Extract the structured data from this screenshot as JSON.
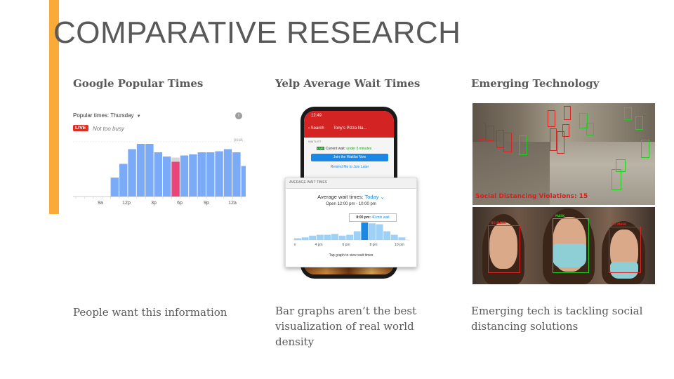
{
  "slide": {
    "title": "COMPARATIVE RESEARCH",
    "accent_color": "#F9AB38",
    "text_color": "#595959"
  },
  "columns": [
    {
      "heading": "Google Popular Times",
      "caption": "People want this information"
    },
    {
      "heading": "Yelp Average Wait Times",
      "caption": "Bar graphs aren’t the best visualization of real world density"
    },
    {
      "heading": "Emerging Technology",
      "caption": "Emerging tech is tackling social distancing solutions"
    }
  ],
  "google_popular_times": {
    "label": "Popular times: Thursday",
    "live_badge": "LIVE",
    "status": "Not too busy",
    "peak_label": "peak",
    "info_icon": "info-icon",
    "chart_data": {
      "type": "bar",
      "categories": [
        "8a",
        "9a",
        "10a",
        "11a",
        "12p",
        "1p",
        "2p",
        "3p",
        "4p",
        "5p",
        "6p",
        "7p",
        "8p",
        "9p",
        "10p",
        "11p",
        "12a"
      ],
      "x_tick_labels": [
        "9a",
        "12p",
        "3p",
        "6p",
        "9p",
        "12a"
      ],
      "values": [
        18,
        31,
        45,
        50,
        50,
        42,
        38,
        37,
        39,
        40,
        42,
        42,
        43,
        45,
        42,
        29
      ],
      "live_value": 33,
      "live_index": 7,
      "colors": {
        "bar": "#7baaf7",
        "live": "#e8457a",
        "live_overlay": "#d7d7d7"
      }
    }
  },
  "yelp_wait_times": {
    "phone": {
      "status_time": "12:49",
      "back_label": "Search",
      "business_name": "Tony's Pizza Na...",
      "waitlist_label": "WAITLIST",
      "live_badge": "LIVE",
      "current_wait_label": "Current wait:",
      "current_wait_value": "under 5 minutes",
      "join_button": "Join the Waitlist Now",
      "remind_link": "Remind Me to Join Later"
    },
    "card": {
      "header": "AVERAGE WAIT TIMES",
      "title_prefix": "Average wait times:",
      "title_day": "Today",
      "hours": "Open 12:00 pm - 10:00 pm",
      "tooltip_time": "8:00 pm:",
      "tooltip_wait": "40 min wait",
      "footer": "Tap graph to view wait times"
    },
    "chart_data": {
      "type": "bar",
      "x_tick_labels": [
        "n",
        "4 pm",
        "6 pm",
        "8 pm",
        "10 pm"
      ],
      "values": [
        2,
        3,
        5,
        6,
        6,
        7,
        5,
        6,
        10,
        20,
        19,
        18,
        10,
        6,
        3
      ],
      "highlight_index": 9,
      "colors": {
        "bar": "#9fd0f5",
        "highlight": "#1b88e6"
      }
    }
  },
  "emerging_tech": {
    "violations_text": "Social Distancing Violations: 15"
  }
}
